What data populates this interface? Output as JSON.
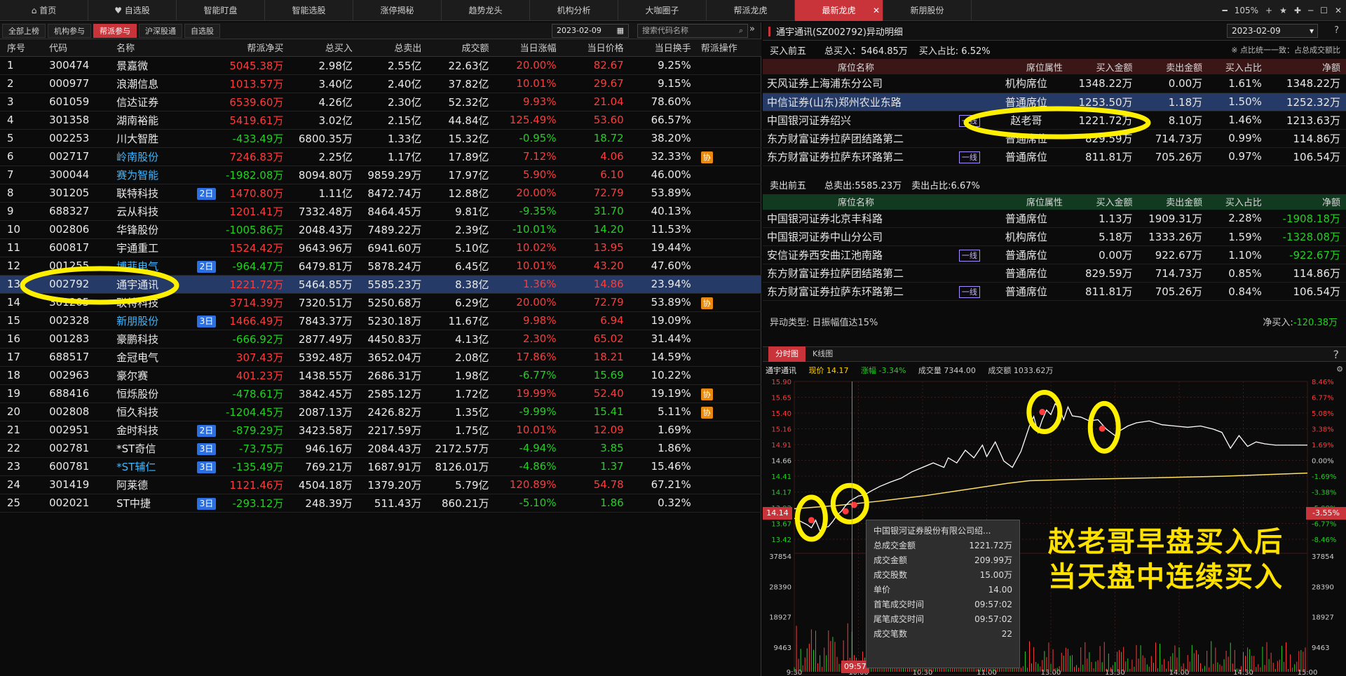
{
  "topbar": {
    "tabs": [
      "首页",
      "自选股",
      "智能盯盘",
      "智能选股",
      "涨停揭秘",
      "趋势龙头",
      "机构分析",
      "大咖圈子",
      "帮派龙虎",
      "最新龙虎",
      "新朋股份"
    ],
    "zoom": "105%"
  },
  "left": {
    "subtabs": [
      "全部上榜",
      "机构参与",
      "帮派参与",
      "沪深股通",
      "自选股"
    ],
    "date": "2023-02-09",
    "search_placeholder": "搜索代码名称",
    "headers": [
      "序号",
      "代码",
      "名称",
      "",
      "帮派净买",
      "总买入",
      "总卖出",
      "成交额",
      "当日涨幅",
      "当日价格",
      "当日换手",
      "帮派操作"
    ],
    "rows": [
      [
        "1",
        "300474",
        "景嘉微",
        "",
        "5045.38万",
        "2.98亿",
        "2.55亿",
        "22.63亿",
        "20.00%",
        "82.67",
        "9.25%",
        ""
      ],
      [
        "2",
        "000977",
        "浪潮信息",
        "",
        "1013.57万",
        "3.40亿",
        "2.40亿",
        "37.82亿",
        "10.01%",
        "29.67",
        "9.15%",
        ""
      ],
      [
        "3",
        "601059",
        "信达证券",
        "",
        "6539.60万",
        "4.26亿",
        "2.30亿",
        "52.32亿",
        "9.93%",
        "21.04",
        "78.60%",
        ""
      ],
      [
        "4",
        "301358",
        "湖南裕能",
        "",
        "5419.61万",
        "3.02亿",
        "2.15亿",
        "44.84亿",
        "125.49%",
        "53.60",
        "66.57%",
        ""
      ],
      [
        "5",
        "002253",
        "川大智胜",
        "",
        "-433.49万",
        "6800.35万",
        "1.33亿",
        "15.32亿",
        "-0.95%",
        "18.72",
        "38.20%",
        ""
      ],
      [
        "6",
        "002717",
        "岭南股份",
        "",
        "7246.83万",
        "2.25亿",
        "1.17亿",
        "17.89亿",
        "7.12%",
        "4.06",
        "32.33%",
        "协"
      ],
      [
        "7",
        "300044",
        "赛为智能",
        "",
        "-1982.08万",
        "8094.80万",
        "9859.29万",
        "17.97亿",
        "5.90%",
        "6.10",
        "46.00%",
        ""
      ],
      [
        "8",
        "301205",
        "联特科技",
        "2日",
        "1470.80万",
        "1.11亿",
        "8472.74万",
        "12.88亿",
        "20.00%",
        "72.79",
        "53.89%",
        ""
      ],
      [
        "9",
        "688327",
        "云从科技",
        "",
        "1201.41万",
        "7332.48万",
        "8464.45万",
        "9.81亿",
        "-9.35%",
        "31.70",
        "40.13%",
        ""
      ],
      [
        "10",
        "002806",
        "华锋股份",
        "",
        "-1005.86万",
        "2048.43万",
        "7489.22万",
        "2.39亿",
        "-10.01%",
        "14.20",
        "11.53%",
        ""
      ],
      [
        "11",
        "600817",
        "宇通重工",
        "",
        "1524.42万",
        "9643.96万",
        "6941.60万",
        "5.10亿",
        "10.02%",
        "13.95",
        "19.44%",
        ""
      ],
      [
        "12",
        "001255",
        "博菲电气",
        "2日",
        "-964.47万",
        "6479.81万",
        "5878.24万",
        "6.45亿",
        "10.01%",
        "43.20",
        "47.60%",
        ""
      ],
      [
        "13",
        "002792",
        "通宇通讯",
        "",
        "1221.72万",
        "5464.85万",
        "5585.23万",
        "8.38亿",
        "1.36%",
        "14.86",
        "23.94%",
        ""
      ],
      [
        "14",
        "301205",
        "联特科技",
        "",
        "3714.39万",
        "7320.51万",
        "5250.68万",
        "6.29亿",
        "20.00%",
        "72.79",
        "53.89%",
        "协"
      ],
      [
        "15",
        "002328",
        "新朋股份",
        "3日",
        "1466.49万",
        "7843.37万",
        "5230.18万",
        "11.67亿",
        "9.98%",
        "6.94",
        "19.09%",
        ""
      ],
      [
        "16",
        "001283",
        "豪鹏科技",
        "",
        "-666.92万",
        "2877.49万",
        "4450.83万",
        "4.13亿",
        "2.30%",
        "65.02",
        "31.44%",
        ""
      ],
      [
        "17",
        "688517",
        "金冠电气",
        "",
        "307.43万",
        "5392.48万",
        "3652.04万",
        "2.08亿",
        "17.86%",
        "18.21",
        "14.59%",
        ""
      ],
      [
        "18",
        "002963",
        "豪尔赛",
        "",
        "401.23万",
        "1438.55万",
        "2686.31万",
        "1.98亿",
        "-6.77%",
        "15.69",
        "10.22%",
        ""
      ],
      [
        "19",
        "688416",
        "恒烁股份",
        "",
        "-478.61万",
        "3842.45万",
        "2585.12万",
        "1.72亿",
        "19.99%",
        "52.40",
        "19.19%",
        "协"
      ],
      [
        "20",
        "002808",
        "恒久科技",
        "",
        "-1204.45万",
        "2087.13万",
        "2426.82万",
        "1.35亿",
        "-9.99%",
        "15.41",
        "5.11%",
        "协"
      ],
      [
        "21",
        "002951",
        "金时科技",
        "2日",
        "-879.29万",
        "3423.58万",
        "2217.59万",
        "1.75亿",
        "10.01%",
        "12.09",
        "1.69%",
        ""
      ],
      [
        "22",
        "002781",
        "*ST奇信",
        "3日",
        "-73.75万",
        "946.16万",
        "2084.43万",
        "2172.57万",
        "-4.94%",
        "3.85",
        "1.86%",
        ""
      ],
      [
        "23",
        "600781",
        "*ST辅仁",
        "3日",
        "-135.49万",
        "769.21万",
        "1687.91万",
        "8126.01万",
        "-4.86%",
        "1.37",
        "15.46%",
        ""
      ],
      [
        "24",
        "301419",
        "阿莱德",
        "",
        "1121.46万",
        "4504.18万",
        "1379.20万",
        "5.79亿",
        "120.89%",
        "54.78",
        "67.21%",
        ""
      ],
      [
        "25",
        "002021",
        "ST中捷",
        "3日",
        "-293.12万",
        "248.39万",
        "511.43万",
        "860.21万",
        "-5.10%",
        "1.86",
        "0.32%",
        ""
      ]
    ]
  },
  "right": {
    "title": "通宇通讯(SZ002792)异动明细",
    "date": "2023-02-09",
    "buy_summary": {
      "label": "买入前五",
      "total": "总买入：5464.85万",
      "ratio": "买入占比: 6.52%",
      "note": "※ 点比统一一致：占总成交额比"
    },
    "buy_headers": [
      "席位名称",
      "",
      "席位属性",
      "买入金额",
      "卖出金额",
      "买入占比",
      "净额"
    ],
    "buy_rows": [
      [
        "天风证券上海浦东分公司",
        "",
        "机构席位",
        "1348.22万",
        "0.00万",
        "1.61%",
        "1348.22万"
      ],
      [
        "中信证券(山东)郑州农业东路",
        "",
        "普通席位",
        "1253.50万",
        "1.18万",
        "1.50%",
        "1252.32万"
      ],
      [
        "中国银河证券绍兴",
        "一线",
        "赵老哥",
        "1221.72万",
        "8.10万",
        "1.46%",
        "1213.63万"
      ],
      [
        "东方财富证券拉萨团结路第二",
        "",
        "普通席位",
        "829.59万",
        "714.73万",
        "0.99%",
        "114.86万"
      ],
      [
        "东方财富证券拉萨东环路第二",
        "一线",
        "普通席位",
        "811.81万",
        "705.26万",
        "0.97%",
        "106.54万"
      ]
    ],
    "sell_summary": {
      "label": "卖出前五",
      "total": "总卖出:5585.23万",
      "ratio": "卖出占比:6.67%"
    },
    "sell_rows": [
      [
        "中国银河证券北京丰科路",
        "",
        "普通席位",
        "1.13万",
        "1909.31万",
        "2.28%",
        "-1908.18万"
      ],
      [
        "中国银河证券中山分公司",
        "",
        "机构席位",
        "5.18万",
        "1333.26万",
        "1.59%",
        "-1328.08万"
      ],
      [
        "安信证券西安曲江池南路",
        "一线",
        "普通席位",
        "0.00万",
        "922.67万",
        "1.10%",
        "-922.67万"
      ],
      [
        "东方财富证券拉萨团结路第二",
        "",
        "普通席位",
        "829.59万",
        "714.73万",
        "0.85%",
        "114.86万"
      ],
      [
        "东方财富证券拉萨东环路第二",
        "一线",
        "普通席位",
        "811.81万",
        "705.26万",
        "0.84%",
        "106.54万"
      ]
    ],
    "anomaly": "异动类型: 日振幅值达15%",
    "net_buy_label": "净买入:",
    "net_buy_value": "-120.38万",
    "chart_tabs": [
      "分时图",
      "K线图"
    ],
    "chart_info": {
      "name": "通宇通讯",
      "price_label": "现价",
      "price": "14.17",
      "change_label": "涨幅",
      "change": "-3.34%",
      "volume_label": "成交量",
      "volume": "7344.00",
      "amount_label": "成交额",
      "amount": "1033.62万"
    },
    "tooltip": {
      "title": "中国银河证券股份有限公司绍...",
      "rows": [
        [
          "总成交金额",
          "1221.72万"
        ],
        [
          "成交金额",
          "209.99万"
        ],
        [
          "成交股数",
          "15.00万"
        ],
        [
          "单价",
          "14.00"
        ],
        [
          "首笔成交时间",
          "09:57:02"
        ],
        [
          "尾笔成交时间",
          "09:57:02"
        ],
        [
          "成交笔数",
          "22"
        ]
      ]
    },
    "annotation": [
      "赵老哥早盘买入后",
      "当天盘中连续买入"
    ],
    "cursor_time": "09:57",
    "cursor_price": "14.14",
    "cursor_pct": "-3.55%"
  },
  "chart_data": {
    "type": "line",
    "x_ticks": [
      "9:30",
      "10:00",
      "10:30",
      "11:00",
      "13:00",
      "13:30",
      "14:00",
      "14:30",
      "15:00"
    ],
    "price_ticks": [
      "15.90",
      "15.65",
      "15.40",
      "15.16",
      "14.91",
      "14.66",
      "14.41",
      "14.17",
      "13.92",
      "13.67",
      "13.42"
    ],
    "pct_ticks": [
      "8.46%",
      "6.77%",
      "5.08%",
      "3.38%",
      "1.69%",
      "0.00%",
      "-1.69%",
      "-3.38%",
      "-5.08%",
      "-6.77%",
      "-8.46%"
    ],
    "volume_ticks": [
      "37854",
      "28390",
      "18927",
      "9463"
    ],
    "ylim": [
      13.42,
      15.9
    ],
    "price": [
      [
        0,
        13.75
      ],
      [
        3,
        13.7
      ],
      [
        6,
        13.65
      ],
      [
        8,
        13.6
      ],
      [
        10,
        13.72
      ],
      [
        12,
        13.55
      ],
      [
        14,
        13.6
      ],
      [
        16,
        13.62
      ],
      [
        18,
        13.7
      ],
      [
        20,
        13.8
      ],
      [
        22,
        13.86
      ],
      [
        24,
        13.95
      ],
      [
        26,
        14.02
      ],
      [
        28,
        14.06
      ],
      [
        30,
        14.1
      ],
      [
        33,
        14.12
      ],
      [
        36,
        14.18
      ],
      [
        40,
        14.25
      ],
      [
        45,
        14.32
      ],
      [
        50,
        14.38
      ],
      [
        55,
        14.48
      ],
      [
        60,
        14.55
      ],
      [
        65,
        14.62
      ],
      [
        70,
        14.55
      ],
      [
        72,
        14.7
      ],
      [
        76,
        14.62
      ],
      [
        80,
        14.82
      ],
      [
        84,
        14.7
      ],
      [
        88,
        14.9
      ],
      [
        90,
        14.72
      ],
      [
        94,
        14.95
      ],
      [
        98,
        14.65
      ],
      [
        102,
        14.55
      ],
      [
        106,
        14.8
      ],
      [
        110,
        15.2
      ],
      [
        112,
        15.35
      ],
      [
        114,
        15.1
      ],
      [
        116,
        15.3
      ],
      [
        118,
        15.45
      ],
      [
        120,
        15.38
      ],
      [
        122,
        15.55
      ],
      [
        124,
        15.48
      ],
      [
        126,
        15.3
      ],
      [
        128,
        15.5
      ],
      [
        130,
        15.36
      ],
      [
        134,
        15.34
      ],
      [
        138,
        15.28
      ],
      [
        142,
        15.3
      ],
      [
        146,
        15.15
      ],
      [
        150,
        15.05
      ],
      [
        152,
        15.12
      ],
      [
        156,
        15.2
      ],
      [
        160,
        15.25
      ],
      [
        166,
        15.28
      ],
      [
        172,
        15.22
      ],
      [
        178,
        15.2
      ],
      [
        184,
        15.18
      ],
      [
        190,
        15.2
      ],
      [
        196,
        15.15
      ],
      [
        200,
        15.1
      ],
      [
        204,
        14.85
      ],
      [
        208,
        15.05
      ],
      [
        212,
        14.88
      ],
      [
        216,
        14.95
      ],
      [
        220,
        14.92
      ],
      [
        225,
        14.9
      ],
      [
        232,
        14.9
      ],
      [
        240,
        14.9
      ]
    ],
    "avg": [
      [
        0,
        13.9
      ],
      [
        20,
        13.95
      ],
      [
        40,
        14.02
      ],
      [
        60,
        14.1
      ],
      [
        80,
        14.2
      ],
      [
        100,
        14.3
      ],
      [
        110,
        14.34
      ],
      [
        130,
        14.36
      ],
      [
        160,
        14.38
      ],
      [
        200,
        14.41
      ],
      [
        240,
        14.46
      ]
    ],
    "buy_points": [
      [
        8,
        13.72
      ],
      [
        24,
        13.86
      ],
      [
        28,
        13.96
      ],
      [
        116,
        15.42
      ],
      [
        144,
        15.16
      ]
    ]
  }
}
